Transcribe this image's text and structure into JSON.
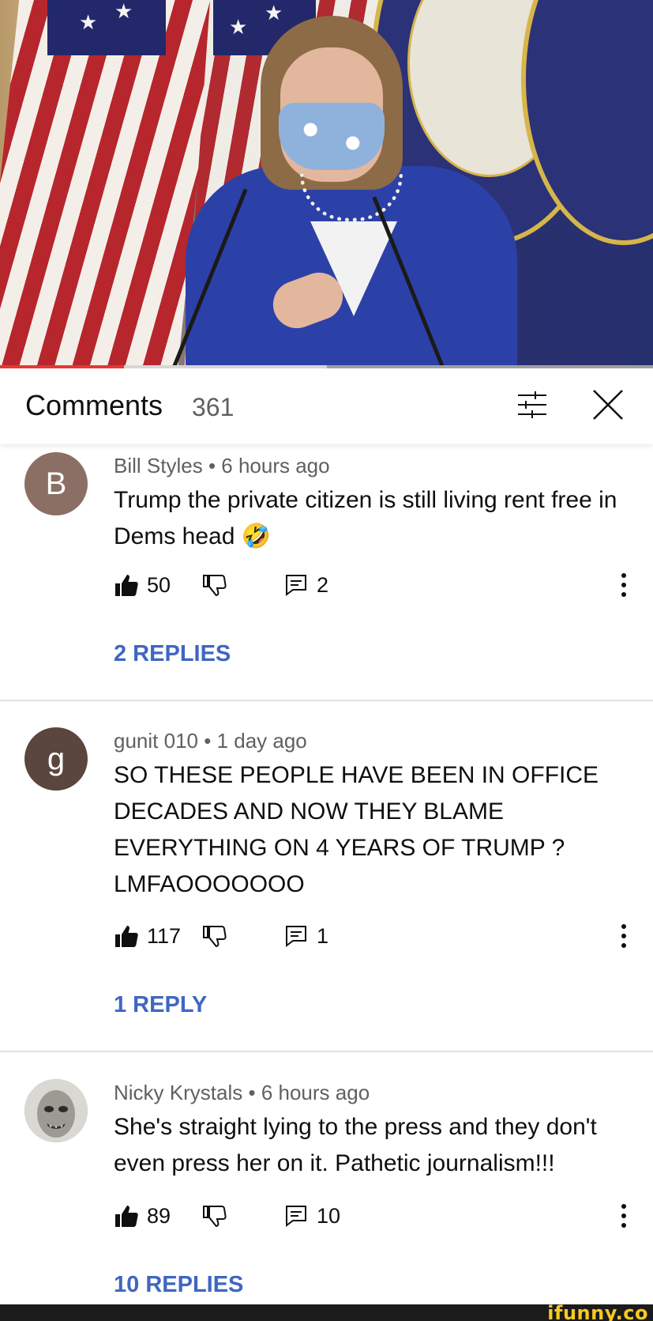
{
  "header": {
    "title": "Comments",
    "count": "361",
    "sort_icon": "sort-filter-icon",
    "close_icon": "close-icon"
  },
  "video": {
    "progress_fraction": 0.19,
    "buffer_fraction": 0.5
  },
  "comments": [
    {
      "avatar_letter": "B",
      "avatar_color": "#8b6f64",
      "author": "Bill Styles",
      "separator": "•",
      "time": "6 hours ago",
      "text": "Trump the private citizen is still living rent free in Dems head 🤣",
      "likes": "50",
      "reply_count": "2",
      "replies_label": "2 REPLIES"
    },
    {
      "avatar_letter": "g",
      "avatar_color": "#5a463c",
      "author": "gunit 010",
      "separator": "•",
      "time": "1 day ago",
      "text": "SO THESE PEOPLE HAVE BEEN IN OFFICE DECADES AND NOW THEY BLAME EVERYTHING ON 4 YEARS OF TRUMP ? LMFAOOOOOOO",
      "likes": "117",
      "reply_count": "1",
      "replies_label": "1 REPLY"
    },
    {
      "avatar_letter": "",
      "avatar_color": "#9a9a94",
      "author": "Nicky Krystals",
      "separator": "•",
      "time": "6 hours ago",
      "text": "She's straight lying to the press and they don't even press her on it. Pathetic journalism!!!",
      "likes": "89",
      "reply_count": "10",
      "replies_label": "10 REPLIES"
    }
  ],
  "footer": {
    "watermark": "ifunny.co"
  },
  "colors": {
    "link_blue": "#3f66c2",
    "progress_red": "#e53935"
  }
}
